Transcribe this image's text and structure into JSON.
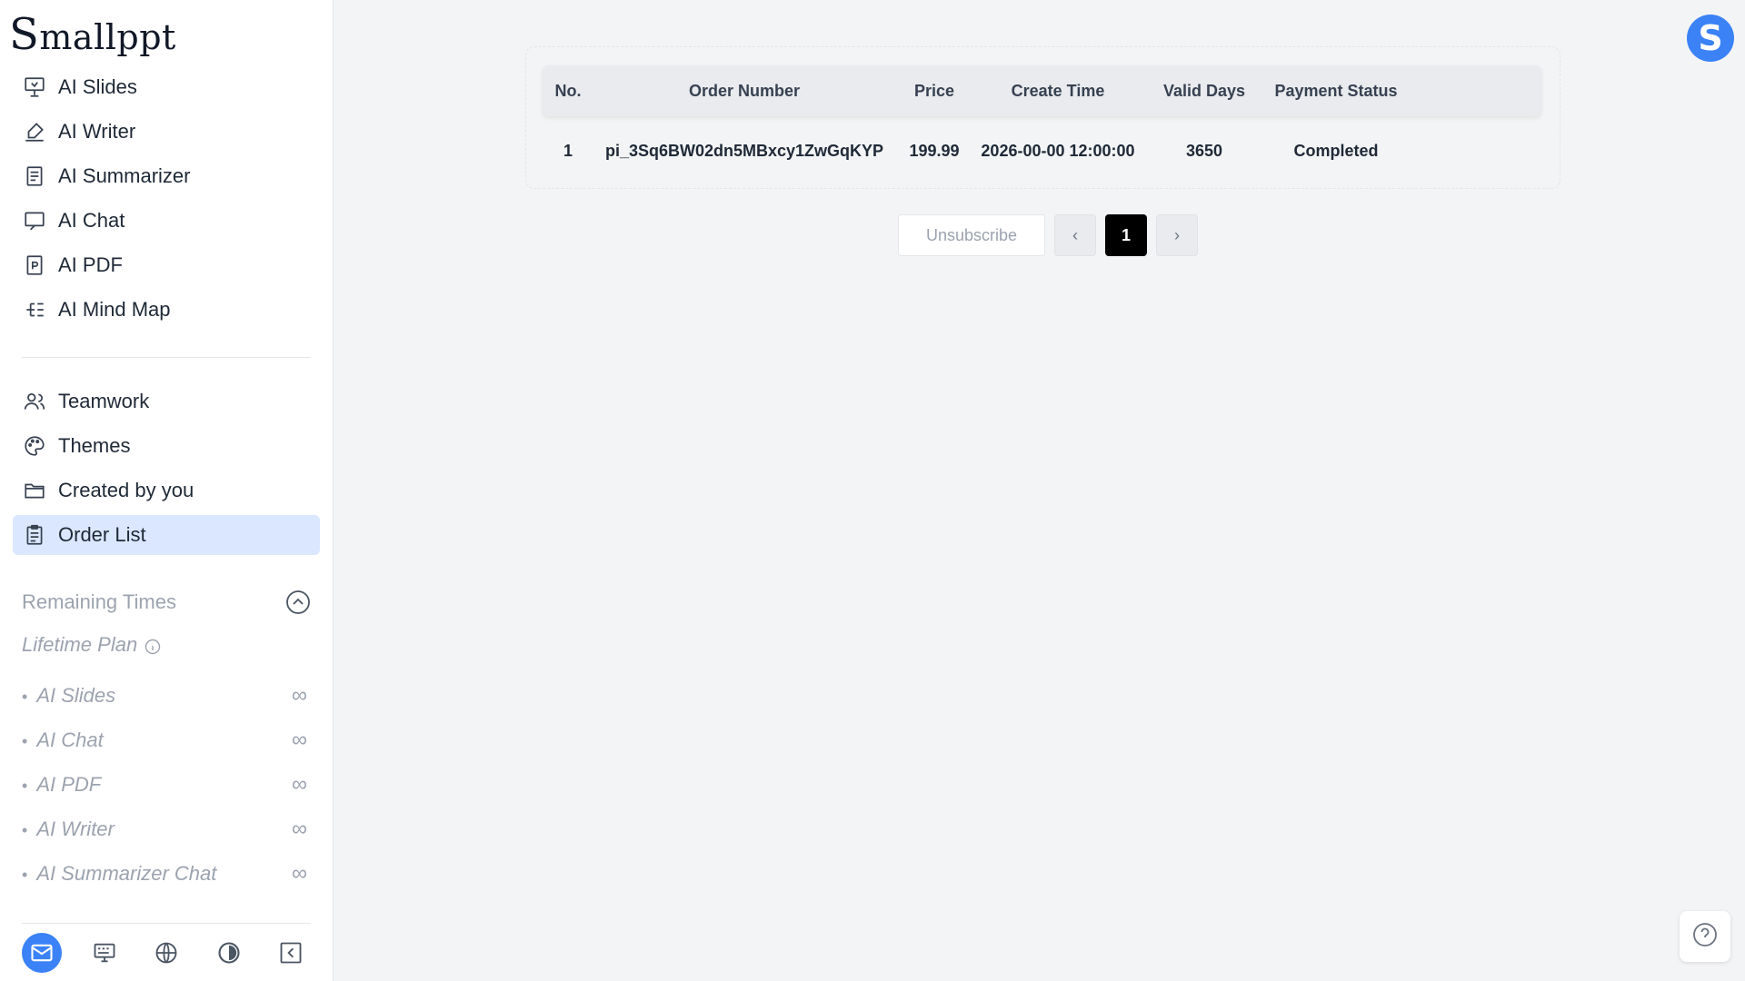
{
  "app": {
    "logo_first": "S",
    "logo_rest": "mallppt"
  },
  "sidebar": {
    "tools": [
      {
        "label": "AI Slides",
        "icon": "presentation-icon"
      },
      {
        "label": "AI Writer",
        "icon": "pen-writing-icon"
      },
      {
        "label": "AI Summarizer",
        "icon": "document-lines-icon"
      },
      {
        "label": "AI Chat",
        "icon": "chat-screen-icon"
      },
      {
        "label": "AI PDF",
        "icon": "pdf-icon"
      },
      {
        "label": "AI Mind Map",
        "icon": "mind-map-icon"
      }
    ],
    "workspace": [
      {
        "label": "Teamwork",
        "icon": "users-icon"
      },
      {
        "label": "Themes",
        "icon": "palette-icon"
      },
      {
        "label": "Created by you",
        "icon": "folder-icon"
      },
      {
        "label": "Order List",
        "icon": "clipboard-icon",
        "active": true
      }
    ],
    "remaining": {
      "title": "Remaining Times",
      "plan": "Lifetime Plan",
      "items": [
        {
          "label": "AI Slides",
          "value": "∞"
        },
        {
          "label": "AI Chat",
          "value": "∞"
        },
        {
          "label": "AI PDF",
          "value": "∞"
        },
        {
          "label": "AI Writer",
          "value": "∞"
        },
        {
          "label": "AI Summarizer Chat",
          "value": "∞"
        }
      ]
    },
    "bottom_icons": [
      "mail-icon",
      "keyboard-icon",
      "globe-icon",
      "contrast-icon",
      "collapse-sidebar-icon"
    ]
  },
  "orders": {
    "columns": [
      "No.",
      "Order Number",
      "Price",
      "Create Time",
      "Valid Days",
      "Payment Status"
    ],
    "rows": [
      [
        "1",
        "pi_3Sq6BW02dn5MBxcy1ZwGqKYP",
        "199.99",
        "2026-00-00 12:00:00",
        "3650",
        "Completed"
      ]
    ]
  },
  "pager": {
    "unsubscribe": "Unsubscribe",
    "prev": "‹",
    "current": "1",
    "next": "›"
  },
  "user": {
    "avatar_letter": "S"
  },
  "colors": {
    "accent": "#3b82f6",
    "active_bg": "#dbe7ff",
    "page_bg": "#f3f4f5"
  }
}
